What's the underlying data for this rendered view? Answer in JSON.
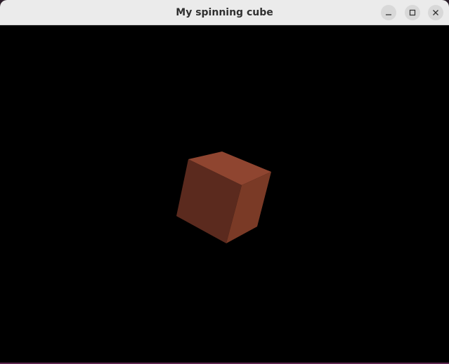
{
  "window": {
    "title": "My spinning cube",
    "controls": [
      {
        "name": "minimize-button",
        "icon": "minimize-icon"
      },
      {
        "name": "maximize-button",
        "icon": "maximize-icon"
      },
      {
        "name": "close-button",
        "icon": "close-icon"
      }
    ]
  },
  "scene": {
    "background": "#000000",
    "cube": {
      "top_face_color": "#8f4530",
      "left_face_color": "#5b2a1e",
      "right_face_color": "#7a3a26"
    }
  }
}
